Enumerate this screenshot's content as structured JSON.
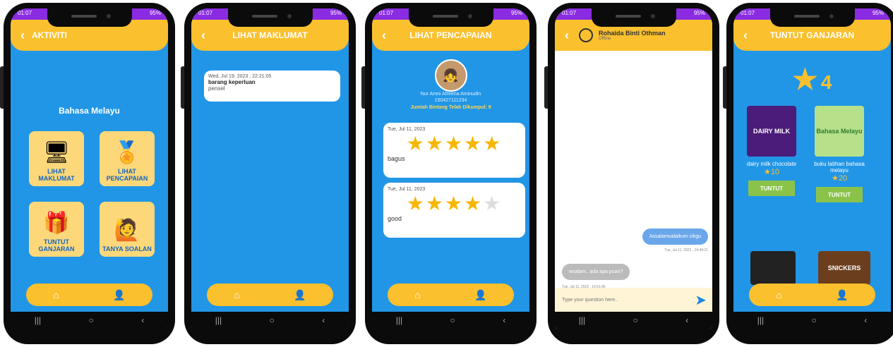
{
  "status": {
    "time": "01:07",
    "battery": "95%"
  },
  "p1": {
    "title": "AKTIVITI",
    "subject": "Bahasa Melayu",
    "buttons": [
      {
        "label": "LIHAT MAKLUMAT",
        "icon": "web-dashboard-icon"
      },
      {
        "label": "LIHAT PENCAPAIAN",
        "icon": "award-icon"
      },
      {
        "label": "TUNTUT GANJARAN",
        "icon": "gift-icon"
      },
      {
        "label": "TANYA SOALAN",
        "icon": "question-person-icon"
      }
    ]
  },
  "p2": {
    "title": "LIHAT MAKLUMAT",
    "card": {
      "date": "Wed, Jul 19, 2023 , 22:21:05",
      "heading": "barang keperluan",
      "text": "pensel"
    }
  },
  "p3": {
    "title": "LIHAT PENCAPAIAN",
    "name": "Nur Amni Afreena Aminudin",
    "id": "150427111234",
    "total": "Jumlah Bintang Telah Dikumpul: 9",
    "entries": [
      {
        "date": "Tue, Jul 11, 2023",
        "stars": 5,
        "comment": "bagus"
      },
      {
        "date": "Tue, Jul 11, 2023",
        "stars": 4,
        "comment": "good"
      }
    ]
  },
  "p4": {
    "contact": "Rohaida Binti Othman",
    "state": "Offline",
    "messages": [
      {
        "text": "Assalamualaikum cikgu",
        "time": "Tue, Jul 11, 2023 , 14:44:21",
        "side": "right"
      },
      {
        "text": "wsalam.. ada apa puan?",
        "time": "Tue, Jul 11, 2023 , 14:51:06",
        "side": "left"
      }
    ],
    "placeholder": "Type your question here.."
  },
  "p5": {
    "title": "TUNTUT GANJARAN",
    "star_count": "4",
    "rewards": [
      {
        "name": "dairy milk chocolate",
        "cost": "10",
        "button": "TUNTUT",
        "brand": "DAIRY MILK",
        "color": "#4b1c7a"
      },
      {
        "name": "buku latihan bahasa melayu",
        "cost": "20",
        "button": "TUNTUT",
        "brand": "Bahasa Melayu",
        "color": "#b7e08a"
      }
    ],
    "partial_rewards": [
      {
        "brand": "",
        "color": "#222222"
      },
      {
        "brand": "SNICKERS",
        "color": "#6b3e1e"
      }
    ]
  },
  "colors": {
    "primary": "#2196e6",
    "accent": "#fbc02d"
  }
}
